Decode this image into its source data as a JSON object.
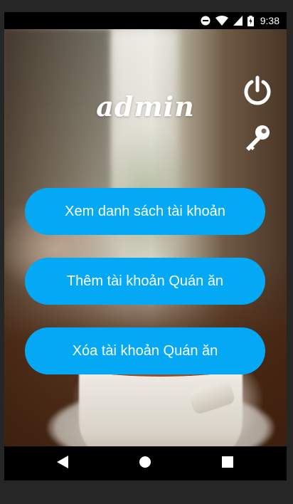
{
  "statusbar": {
    "time": "9:38",
    "icons": [
      "do-not-disturb-icon",
      "wifi-icon",
      "signal-icon",
      "battery-charging-icon"
    ]
  },
  "header": {
    "title": "admin",
    "actions": [
      {
        "name": "power-icon"
      },
      {
        "name": "key-icon"
      }
    ]
  },
  "menu": {
    "buttons": [
      {
        "label": "Xem danh sách tài khoản"
      },
      {
        "label": "Thêm tài khoản Quán ăn"
      },
      {
        "label": "Xóa tài khoản Quán ăn"
      }
    ]
  },
  "navbar": {
    "items": [
      "back-icon",
      "home-icon",
      "recent-apps-icon"
    ]
  },
  "colors": {
    "button": "#05a8f4",
    "text": "#ffffff",
    "bars": "#000000"
  }
}
